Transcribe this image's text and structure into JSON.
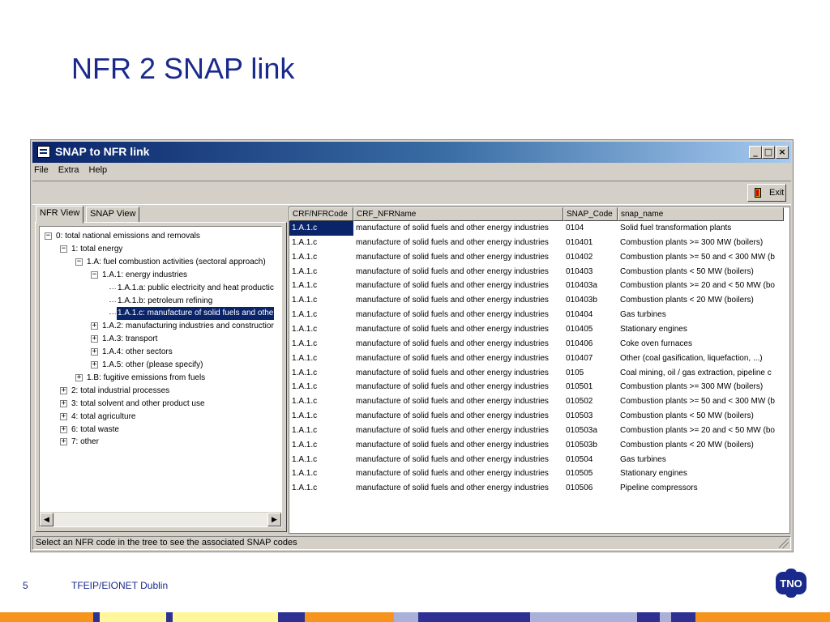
{
  "slide": {
    "title": "NFR 2 SNAP link",
    "page_number": "5",
    "footer_text": "TFEIP/EIONET Dublin",
    "logo_text": "TNO"
  },
  "window": {
    "title": "SNAP to NFR link",
    "menu": [
      "File",
      "Extra",
      "Help"
    ],
    "buttons": {
      "minimize": "_",
      "maximize": "□",
      "close": "×"
    },
    "exit_label": "Exit",
    "status": "Select an NFR code in the tree to see the associated SNAP codes"
  },
  "tabs": [
    {
      "label": "NFR View",
      "active": true
    },
    {
      "label": "SNAP View",
      "active": false
    }
  ],
  "tree": [
    {
      "level": 0,
      "toggle": "−",
      "label": "0: total national emissions and removals"
    },
    {
      "level": 1,
      "toggle": "−",
      "label": "1: total energy"
    },
    {
      "level": 2,
      "toggle": "−",
      "label": "1.A: fuel combustion activities (sectoral approach)"
    },
    {
      "level": 3,
      "toggle": "−",
      "label": "1.A.1: energy industries"
    },
    {
      "level": 4,
      "toggle": "",
      "label": "1.A.1.a: public electricity and heat productic"
    },
    {
      "level": 4,
      "toggle": "",
      "label": "1.A.1.b: petroleum refining"
    },
    {
      "level": 4,
      "toggle": "",
      "label": "1.A.1.c: manufacture of solid fuels and othe",
      "selected": true
    },
    {
      "level": 3,
      "toggle": "+",
      "label": "1.A.2: manufacturing industries and constructior"
    },
    {
      "level": 3,
      "toggle": "+",
      "label": "1.A.3: transport"
    },
    {
      "level": 3,
      "toggle": "+",
      "label": "1.A.4: other sectors"
    },
    {
      "level": 3,
      "toggle": "+",
      "label": "1.A.5: other (please specify)"
    },
    {
      "level": 2,
      "toggle": "+",
      "label": "1.B: fugitive emissions from fuels"
    },
    {
      "level": 1,
      "toggle": "+",
      "label": "2: total industrial processes"
    },
    {
      "level": 1,
      "toggle": "+",
      "label": "3: total solvent and other product use"
    },
    {
      "level": 1,
      "toggle": "+",
      "label": "4: total agriculture"
    },
    {
      "level": 1,
      "toggle": "+",
      "label": "6: total waste"
    },
    {
      "level": 1,
      "toggle": "+",
      "label": "7: other"
    }
  ],
  "grid": {
    "columns": [
      "CRF/NFRCode",
      "CRF_NFRName",
      "SNAP_Code",
      "snap_name"
    ],
    "rows": [
      [
        "1.A.1.c",
        "manufacture of solid fuels and other energy industries",
        "0104",
        "Solid fuel transformation plants"
      ],
      [
        "1.A.1.c",
        "manufacture of solid fuels and other energy industries",
        "010401",
        "Combustion plants >= 300 MW (boilers)"
      ],
      [
        "1.A.1.c",
        "manufacture of solid fuels and other energy industries",
        "010402",
        "Combustion plants >= 50 and < 300 MW (b"
      ],
      [
        "1.A.1.c",
        "manufacture of solid fuels and other energy industries",
        "010403",
        "Combustion plants < 50 MW (boilers)"
      ],
      [
        "1.A.1.c",
        "manufacture of solid fuels and other energy industries",
        "010403a",
        "Combustion plants >= 20 and < 50 MW (bo"
      ],
      [
        "1.A.1.c",
        "manufacture of solid fuels and other energy industries",
        "010403b",
        "Combustion plants < 20 MW (boilers)"
      ],
      [
        "1.A.1.c",
        "manufacture of solid fuels and other energy industries",
        "010404",
        "Gas turbines"
      ],
      [
        "1.A.1.c",
        "manufacture of solid fuels and other energy industries",
        "010405",
        "Stationary engines"
      ],
      [
        "1.A.1.c",
        "manufacture of solid fuels and other energy industries",
        "010406",
        "Coke oven furnaces"
      ],
      [
        "1.A.1.c",
        "manufacture of solid fuels and other energy industries",
        "010407",
        "Other (coal gasification, liquefaction, ...)"
      ],
      [
        "1.A.1.c",
        "manufacture of solid fuels and other energy industries",
        "0105",
        "Coal mining, oil / gas extraction, pipeline c"
      ],
      [
        "1.A.1.c",
        "manufacture of solid fuels and other energy industries",
        "010501",
        "Combustion plants >= 300 MW (boilers)"
      ],
      [
        "1.A.1.c",
        "manufacture of solid fuels and other energy industries",
        "010502",
        "Combustion plants >= 50 and < 300 MW (b"
      ],
      [
        "1.A.1.c",
        "manufacture of solid fuels and other energy industries",
        "010503",
        "Combustion plants < 50 MW (boilers)"
      ],
      [
        "1.A.1.c",
        "manufacture of solid fuels and other energy industries",
        "010503a",
        "Combustion plants >= 20 and < 50 MW (bo"
      ],
      [
        "1.A.1.c",
        "manufacture of solid fuels and other energy industries",
        "010503b",
        "Combustion plants < 20 MW (boilers)"
      ],
      [
        "1.A.1.c",
        "manufacture of solid fuels and other energy industries",
        "010504",
        "Gas turbines"
      ],
      [
        "1.A.1.c",
        "manufacture of solid fuels and other energy industries",
        "010505",
        "Stationary engines"
      ],
      [
        "1.A.1.c",
        "manufacture of solid fuels and other energy industries",
        "010506",
        "Pipeline compressors"
      ]
    ]
  },
  "colors": {
    "title_text": "#1a2a8c",
    "selection": "#0a246a",
    "footer_orange": "#f7941d",
    "footer_yellow": "#fff799",
    "footer_navy": "#2e3192",
    "footer_lavender": "#aab0d8"
  }
}
